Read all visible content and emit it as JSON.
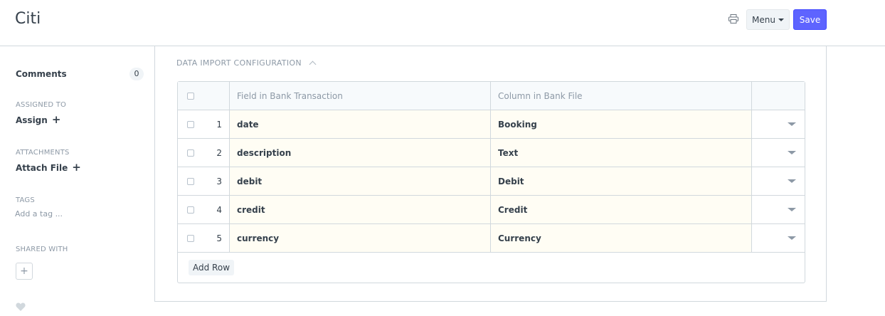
{
  "header": {
    "title": "Citi",
    "menu_label": "Menu",
    "save_label": "Save"
  },
  "sidebar": {
    "comments_label": "Comments",
    "comments_count": "0",
    "assigned_heading": "ASSIGNED TO",
    "assign_label": "Assign",
    "attachments_heading": "ATTACHMENTS",
    "attach_label": "Attach File",
    "tags_heading": "TAGS",
    "tag_placeholder": "Add a tag ...",
    "shared_heading": "SHARED WITH"
  },
  "section": {
    "title": "DATA IMPORT CONFIGURATION"
  },
  "table": {
    "columns": [
      "Field in Bank Transaction",
      "Column in Bank File"
    ],
    "rows": [
      {
        "idx": "1",
        "field": "date",
        "column": "Booking"
      },
      {
        "idx": "2",
        "field": "description",
        "column": "Text"
      },
      {
        "idx": "3",
        "field": "debit",
        "column": "Debit"
      },
      {
        "idx": "4",
        "field": "credit",
        "column": "Credit"
      },
      {
        "idx": "5",
        "field": "currency",
        "column": "Currency"
      }
    ],
    "add_row_label": "Add Row"
  },
  "colors": {
    "primary": "#5e64ff",
    "row_highlight": "#fffdf4",
    "muted_text": "#8d99a6"
  },
  "icons": [
    "print-icon",
    "caret-down-icon",
    "plus-icon",
    "chevron-up-icon",
    "heart-icon",
    "dropdown-icon"
  ]
}
